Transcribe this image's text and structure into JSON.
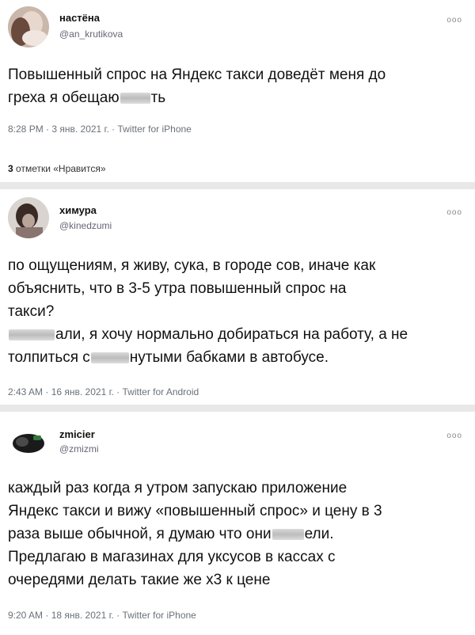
{
  "tweets": [
    {
      "name": "настёна",
      "handle": "@an_krutikova",
      "more": "ooo",
      "text1": "Повышенный спрос на Яндекс такси доведёт меня до",
      "text2a": "греха я обещаю",
      "text2b": "ть",
      "meta": "8:28 PM · 3 янв. 2021 г. · Twitter for iPhone",
      "likes_count": "3",
      "likes_label": "отметки «Нравится»"
    },
    {
      "name": "химура",
      "handle": "@kinedzumi",
      "more": "ooo",
      "text1": "по ощущениям, я живу, сука, в городе сов, иначе как",
      "text2": "объяснить, что в 3-5 утра повышенный спрос на",
      "text3": "такси?",
      "text4b": "али, я хочу нормально добираться на работу, а не",
      "text5a": "толпиться с",
      "text5b": "нутыми бабками в автобусе.",
      "meta": "2:43 AM · 16 янв. 2021 г. · Twitter for Android"
    },
    {
      "name": "zmicier",
      "handle": "@zmizmi",
      "more": "ooo",
      "text1": "каждый раз когда я утром запускаю приложение",
      "text2": "Яндекс такси и вижу «повышенный спрос» и цену в 3",
      "text3a": "раза выше обычной, я думаю что они",
      "text3b": "ели.",
      "text4": "Предлагаю в магазинах для уксусов в кассах с",
      "text5": "очередями делать такие же х3 к цене",
      "meta": "9:20 AM · 18 янв. 2021 г. · Twitter for iPhone"
    }
  ]
}
